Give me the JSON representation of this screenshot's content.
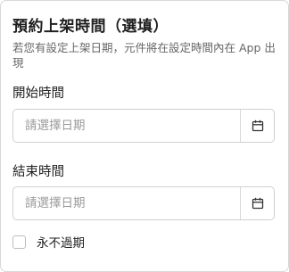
{
  "section": {
    "title": "預約上架時間（選填）",
    "description": "若您有設定上架日期，元件將在設定時間內在 App 出現"
  },
  "start_time": {
    "label": "開始時間",
    "placeholder": "請選擇日期",
    "value": "",
    "icon": "calendar-icon"
  },
  "end_time": {
    "label": "結束時間",
    "placeholder": "請選擇日期",
    "value": "",
    "icon": "calendar-icon"
  },
  "never_expire": {
    "label": "永不過期",
    "checked": false
  }
}
